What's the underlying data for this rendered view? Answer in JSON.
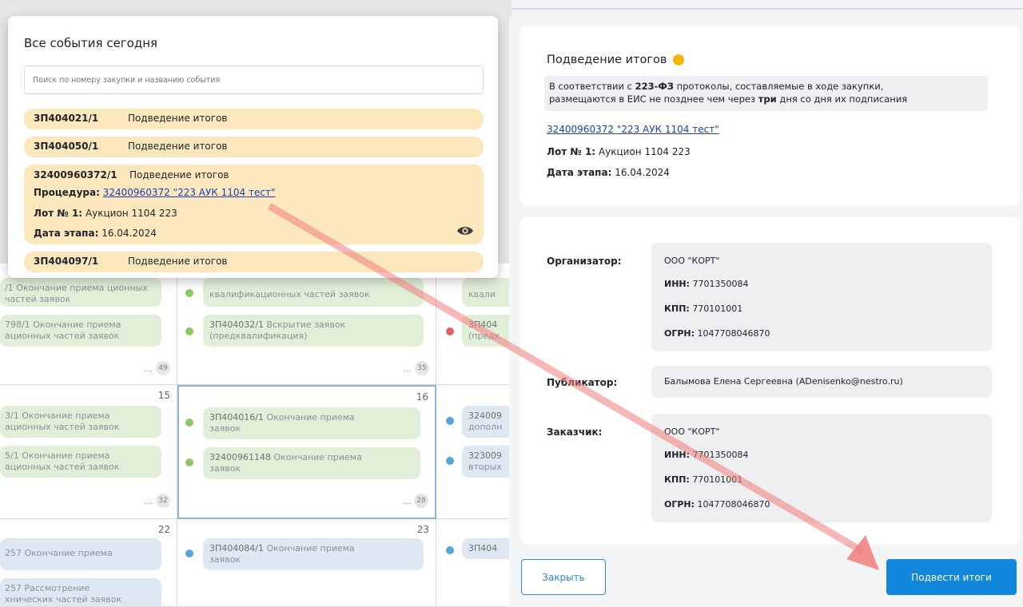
{
  "popup": {
    "title": "Все события сегодня",
    "search_placeholder": "Поиск по номеру закупки и названию события",
    "items": [
      {
        "number": "3П404021/1",
        "name": "Подведение итогов"
      },
      {
        "number": "3П404050/1",
        "name": "Подведение итогов"
      },
      {
        "number": "32400960372/1",
        "name": "Подведение итогов",
        "procedure_label": "Процедура:",
        "procedure_link": "32400960372 \"223 АУК 1104 тест\"",
        "lot_label": "Лот № 1:",
        "lot_value": "Аукцион 1104 223",
        "date_label": "Дата этапа:",
        "date_value": "16.04.2024",
        "icon": "eye-icon"
      },
      {
        "number": "3П404097/1",
        "name": "Подведение итогов"
      }
    ]
  },
  "calendar": {
    "cells": [
      {
        "ev1": "/1 Окончание приема ционных частей заявок",
        "ev2": "798/1 Окончание приема ационных частей заявок",
        "more": "...",
        "count": "49"
      },
      {
        "ev1": "квалификационных частей заявок",
        "ev2_num": "3П404032/1",
        "ev2_text": "Вскрытие заявок",
        "ev2_line2": "(предквалификация)",
        "more": "...",
        "count": "35"
      },
      {
        "ev1": "квали",
        "ev2_num": "3П404",
        "ev2_line2": "(предк"
      },
      {
        "day": "15",
        "ev1": "3/1 Окончание приема ационных частей заявок",
        "ev2": "5/1 Окончание приема ационных частей заявок",
        "more": "...",
        "count": "32"
      },
      {
        "day": "16",
        "ev1_num": "3П404016/1",
        "ev1_text": "Окончание приема",
        "ev1_line2": "заявок",
        "ev2_num": "32400961148",
        "ev2_text": "Окончание приема",
        "ev2_line2": "заявок",
        "more": "...",
        "count": "28"
      },
      {
        "ev1_num": "324009",
        "ev1_line2": "дополн",
        "ev2_num": "323009",
        "ev2_line2": "вторых"
      },
      {
        "day": "22",
        "ev1": "257 Окончание приема",
        "ev2": "257 Рассмотрение",
        "ev2_line2": "хнических частей заявок"
      },
      {
        "day": "23",
        "ev1_num": "3П404084/1",
        "ev1_text": "Окончание приема",
        "ev1_line2": "заявок"
      },
      {
        "ev1_num": "3П404"
      }
    ]
  },
  "details": {
    "title": "Подведение итогов",
    "note_pre": "В соответствии с ",
    "note_bold1": "223-ФЗ",
    "note_mid": " протоколы, составляемые в ходе закупки,",
    "note_line2_pre": "размещаются в ЕИС не позднее чем через ",
    "note_bold2": "три",
    "note_line2_post": " дня со дня их подписания",
    "link": "32400960372 \"223 АУК 1104 тест\"",
    "lot_label": "Лот № 1:",
    "lot_value": "Аукцион 1104 223",
    "date_label": "Дата этапа:",
    "date_value": "16.04.2024"
  },
  "organizer": {
    "label": "Организатор:",
    "name": "ООО \"КОРТ\"",
    "inn_label": "ИНН:",
    "inn": "7701350084",
    "kpp_label": "КПП:",
    "kpp": "770101001",
    "ogrn_label": "ОГРН:",
    "ogrn": "1047708046870"
  },
  "publisher": {
    "label": "Публикатор:",
    "value": "Балымова Елена Сергеевна (ADenisenko@nestro.ru)"
  },
  "customer": {
    "label": "Заказчик:",
    "name": "ООО \"КОРТ\"",
    "inn_label": "ИНН:",
    "inn": "7701350084",
    "kpp_label": "КПП:",
    "kpp": "770101001",
    "ogrn_label": "ОГРН:",
    "ogrn": "1047708046870"
  },
  "buttons": {
    "close": "Закрыть",
    "submit": "Подвести итоги"
  },
  "colors": {
    "accent": "#1187de",
    "popup_item": "#fde7bd",
    "status_yellow": "#f2b60e",
    "annotation_arrow": "#f07c7c"
  }
}
